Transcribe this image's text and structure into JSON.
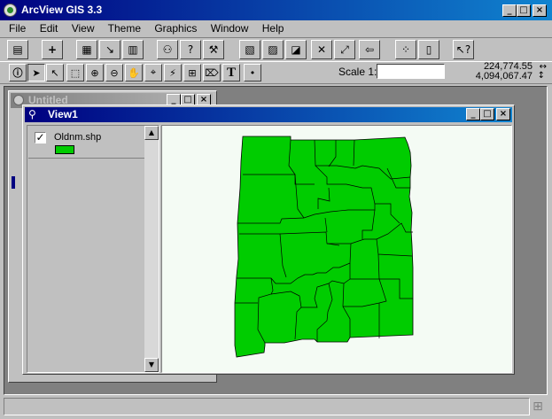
{
  "app": {
    "title": "ArcView GIS 3.3"
  },
  "menu": {
    "items": [
      {
        "label": "File"
      },
      {
        "label": "Edit"
      },
      {
        "label": "View"
      },
      {
        "label": "Theme"
      },
      {
        "label": "Graphics"
      },
      {
        "label": "Window"
      },
      {
        "label": "Help"
      }
    ]
  },
  "toolbar": {
    "buttons": [
      {
        "icon": "save-icon"
      },
      {
        "icon": "add-theme-icon"
      },
      {
        "icon": "theme-properties-icon"
      },
      {
        "icon": "edit-legend-icon"
      },
      {
        "icon": "open-table-icon"
      },
      {
        "icon": "find-icon"
      },
      {
        "icon": "query-builder-icon"
      },
      {
        "icon": "hammer-icon"
      },
      {
        "icon": "zoom-full-extent-icon"
      },
      {
        "icon": "zoom-active-themes-icon"
      },
      {
        "icon": "zoom-selected-icon"
      },
      {
        "icon": "zoom-in-fixed-icon"
      },
      {
        "icon": "zoom-out-fixed-icon"
      },
      {
        "icon": "zoom-previous-icon"
      },
      {
        "icon": "select-by-theme-icon"
      },
      {
        "icon": "clear-selection-icon"
      },
      {
        "icon": "help-icon"
      }
    ]
  },
  "tools": {
    "items": [
      {
        "icon": "identify-icon"
      },
      {
        "icon": "pointer-icon"
      },
      {
        "icon": "vertex-edit-icon"
      },
      {
        "icon": "select-feature-icon"
      },
      {
        "icon": "zoom-in-icon"
      },
      {
        "icon": "zoom-out-icon"
      },
      {
        "icon": "pan-icon"
      },
      {
        "icon": "measure-icon"
      },
      {
        "icon": "hotlink-icon"
      },
      {
        "icon": "area-of-interest-icon"
      },
      {
        "icon": "label-icon"
      },
      {
        "icon": "text-icon"
      },
      {
        "icon": "draw-point-icon"
      }
    ]
  },
  "scale": {
    "label": "Scale 1:",
    "value": ""
  },
  "coords": {
    "x": "224,774.55",
    "y": "4,094,067.47"
  },
  "windows": {
    "untitled": {
      "title": "Untitled"
    },
    "view1": {
      "title": "View1"
    }
  },
  "toc": {
    "themes": [
      {
        "name": "Oldnm.shp",
        "checked": true,
        "color": "#00cc00"
      }
    ]
  },
  "map": {
    "fill": "#00cc00",
    "background": "#f4fbf4"
  }
}
